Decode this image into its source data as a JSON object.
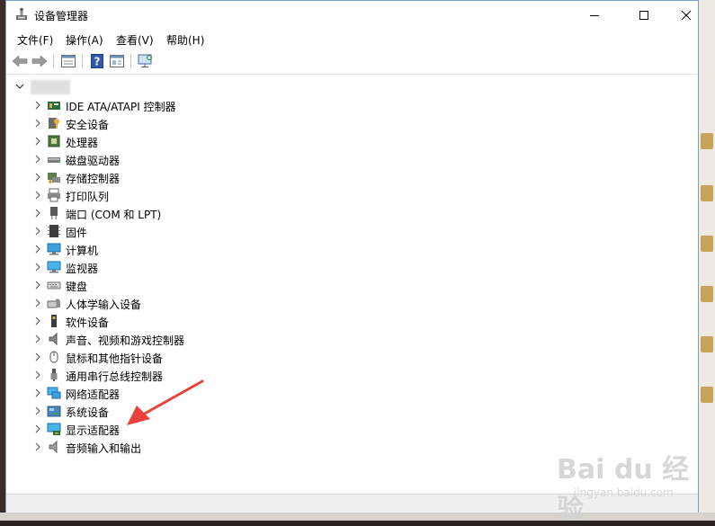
{
  "window": {
    "title": "设备管理器"
  },
  "menu": [
    {
      "label": "文件(F)"
    },
    {
      "label": "操作(A)"
    },
    {
      "label": "查看(V)"
    },
    {
      "label": "帮助(H)"
    }
  ],
  "toolbar": {
    "icons": [
      "back-arrow-icon",
      "forward-arrow-icon",
      "properties-icon",
      "help-icon",
      "show-hidden-icon",
      "monitor-scan-icon"
    ]
  },
  "tree": {
    "items": [
      {
        "label": "IDE ATA/ATAPI 控制器",
        "icon": "ide-controller-icon"
      },
      {
        "label": "安全设备",
        "icon": "security-key-icon"
      },
      {
        "label": "处理器",
        "icon": "processor-icon"
      },
      {
        "label": "磁盘驱动器",
        "icon": "disk-drive-icon"
      },
      {
        "label": "存储控制器",
        "icon": "storage-controller-icon"
      },
      {
        "label": "打印队列",
        "icon": "printer-icon"
      },
      {
        "label": "端口 (COM 和 LPT)",
        "icon": "port-icon"
      },
      {
        "label": "固件",
        "icon": "firmware-icon"
      },
      {
        "label": "计算机",
        "icon": "computer-icon"
      },
      {
        "label": "监视器",
        "icon": "monitor-icon"
      },
      {
        "label": "键盘",
        "icon": "keyboard-icon"
      },
      {
        "label": "人体学输入设备",
        "icon": "hid-icon"
      },
      {
        "label": "软件设备",
        "icon": "software-device-icon"
      },
      {
        "label": "声音、视频和游戏控制器",
        "icon": "speaker-icon"
      },
      {
        "label": "鼠标和其他指针设备",
        "icon": "mouse-icon"
      },
      {
        "label": "通用串行总线控制器",
        "icon": "usb-icon"
      },
      {
        "label": "网络适配器",
        "icon": "network-adapter-icon"
      },
      {
        "label": "系统设备",
        "icon": "system-device-icon"
      },
      {
        "label": "显示适配器",
        "icon": "display-adapter-icon"
      },
      {
        "label": "音频输入和输出",
        "icon": "audio-io-icon"
      }
    ]
  },
  "watermark": {
    "text": "Bai du 经验",
    "sub": "jingyan.baidu.com"
  },
  "colors": {
    "arrow": "#e8423b",
    "window_border": "#7a9fc9"
  }
}
